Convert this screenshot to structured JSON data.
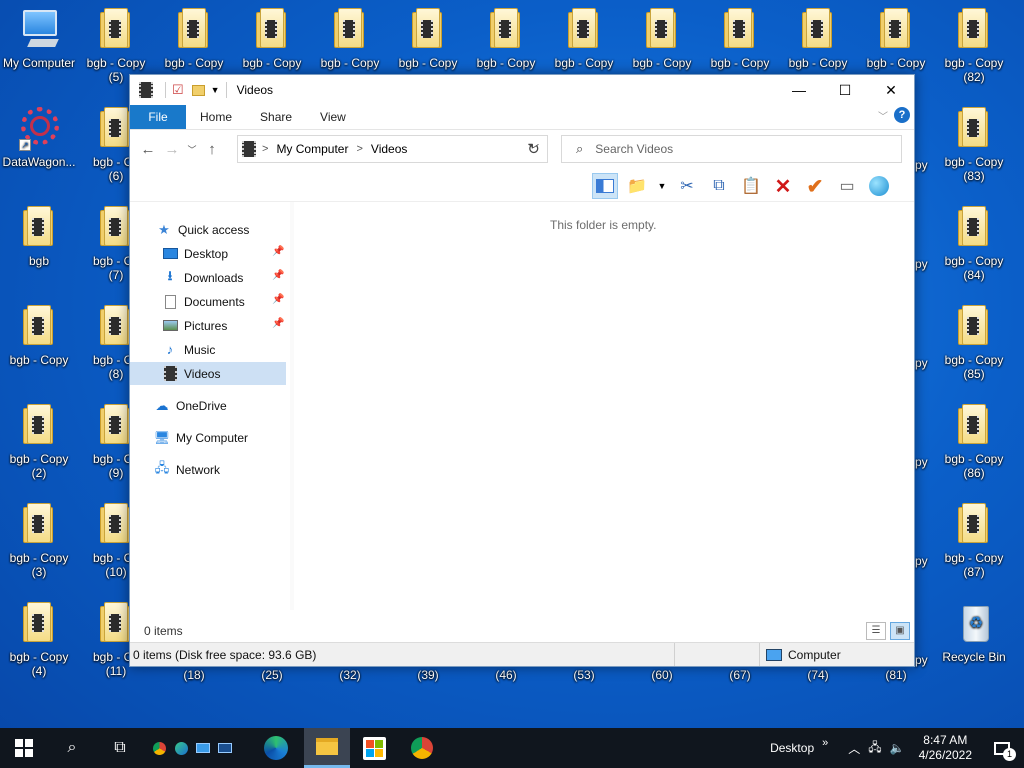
{
  "desktop": {
    "icons": [
      {
        "label": "My Computer",
        "kind": "computer"
      },
      {
        "label": "bgb - Copy",
        "sub": "(5)",
        "kind": "folder"
      },
      {
        "label": "bgb - Copy",
        "kind": "folder"
      },
      {
        "label": "bgb - Copy",
        "kind": "folder"
      },
      {
        "label": "bgb - Copy",
        "kind": "folder"
      },
      {
        "label": "bgb - Copy",
        "kind": "folder"
      },
      {
        "label": "bgb - Copy",
        "kind": "folder"
      },
      {
        "label": "bgb - Copy",
        "kind": "folder"
      },
      {
        "label": "bgb - Copy",
        "kind": "folder"
      },
      {
        "label": "bgb - Copy",
        "kind": "folder"
      },
      {
        "label": "bgb - Copy",
        "kind": "folder"
      },
      {
        "label": "bgb - Copy",
        "kind": "folder"
      },
      {
        "label": "bgb - Copy",
        "sub": "(82)",
        "kind": "folder"
      },
      {
        "label": "DataWagon...",
        "kind": "datawagon"
      },
      {
        "label": "bgb - Co",
        "sub": "(6)",
        "kind": "folder"
      },
      {
        "label": "bgb - Copy",
        "sub": "(83)",
        "kind": "folder"
      },
      {
        "label": "bgb",
        "kind": "folder"
      },
      {
        "label": "bgb - Co",
        "sub": "(7)",
        "kind": "folder"
      },
      {
        "label": "bgb - Copy",
        "sub": "(84)",
        "kind": "folder"
      },
      {
        "label": "bgb - Copy",
        "kind": "folder"
      },
      {
        "label": "bgb - Co",
        "sub": "(8)",
        "kind": "folder"
      },
      {
        "label": "bgb - Copy",
        "sub": "(85)",
        "kind": "folder"
      },
      {
        "label": "bgb - Copy",
        "sub": "(2)",
        "kind": "folder"
      },
      {
        "label": "bgb - Co",
        "sub": "(9)",
        "kind": "folder"
      },
      {
        "label": "bgb - Copy",
        "sub": "(86)",
        "kind": "folder"
      },
      {
        "label": "bgb - Copy",
        "sub": "(3)",
        "kind": "folder"
      },
      {
        "label": "bgb - Co",
        "sub": "(10)",
        "kind": "folder"
      },
      {
        "label": "bgb - Copy",
        "sub": "(87)",
        "kind": "folder"
      },
      {
        "label": "bgb - Copy",
        "sub": "(4)",
        "kind": "folder"
      },
      {
        "label": "bgb - Co",
        "sub": "(11)",
        "kind": "folder"
      },
      {
        "label": "Recycle Bin",
        "kind": "recycle"
      }
    ],
    "right_partials": [
      "py",
      "py",
      "py",
      "py",
      "py",
      "py"
    ],
    "bottom_numbers": [
      "(18)",
      "(25)",
      "(32)",
      "(39)",
      "(46)",
      "(53)",
      "(60)",
      "(67)",
      "(74)",
      "(81)"
    ]
  },
  "window": {
    "title": "Videos",
    "ribbon_tabs": [
      "File",
      "Home",
      "Share",
      "View"
    ],
    "help": "?",
    "breadcrumb": [
      "My Computer",
      "Videos"
    ],
    "search_placeholder": "Search Videos",
    "empty_text": "This folder is empty.",
    "nav": {
      "quick_access": "Quick access",
      "items": [
        {
          "label": "Desktop",
          "icon": "desktop-icon",
          "pinned": true
        },
        {
          "label": "Downloads",
          "icon": "downloads-icon",
          "pinned": true
        },
        {
          "label": "Documents",
          "icon": "documents-icon",
          "pinned": true
        },
        {
          "label": "Pictures",
          "icon": "pictures-icon",
          "pinned": true
        },
        {
          "label": "Music",
          "icon": "music-icon",
          "pinned": false
        },
        {
          "label": "Videos",
          "icon": "videos-icon",
          "pinned": false,
          "selected": true
        }
      ],
      "onedrive": "OneDrive",
      "my_computer": "My Computer",
      "network": "Network"
    },
    "item_count": "0 items",
    "status_left": "0 items (Disk free space: 93.6 GB)",
    "status_right": "Computer"
  },
  "taskbar": {
    "desktop_label": "Desktop",
    "time": "8:47 AM",
    "date": "4/26/2022",
    "notification_count": "1"
  },
  "colors": {
    "accent": "#1979ca",
    "desktop": "#0b5fc9",
    "taskbar": "#10161e",
    "selection": "#cde0f4"
  }
}
